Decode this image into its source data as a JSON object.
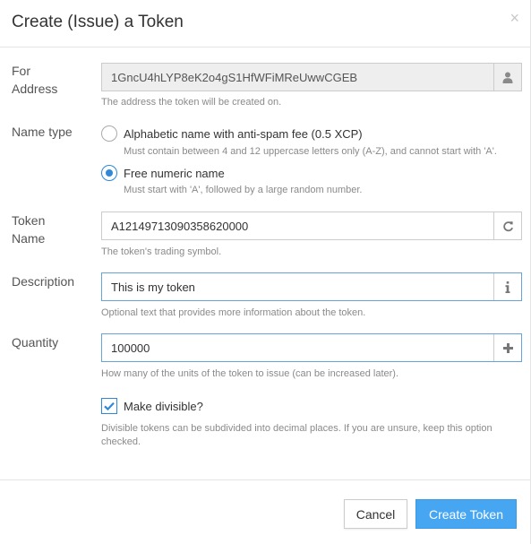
{
  "dialog": {
    "title": "Create (Issue) a Token",
    "close_glyph": "×"
  },
  "address": {
    "label_line1": "For",
    "label_line2": "Address",
    "value": "1GncU4hLYP8eK2o4gS1HfWFiMReUwwCGEB",
    "help": "The address the token will be created on.",
    "icon": "user-icon"
  },
  "name_type": {
    "label": "Name type",
    "options": [
      {
        "label": "Alphabetic name with anti-spam fee (0.5 XCP)",
        "help": "Must contain between 4 and 12 uppercase letters only (A-Z), and cannot start with 'A'.",
        "selected": false
      },
      {
        "label": "Free numeric name",
        "help": "Must start with 'A', followed by a large random number.",
        "selected": true
      }
    ]
  },
  "token_name": {
    "label_line1": "Token",
    "label_line2": "Name",
    "value": "A12149713090358620000",
    "help": "The token's trading symbol.",
    "icon": "refresh-icon"
  },
  "description": {
    "label": "Description",
    "value": "This is my token",
    "help": "Optional text that provides more information about the token.",
    "icon": "info-icon"
  },
  "quantity": {
    "label": "Quantity",
    "value": "100000",
    "help": "How many of the units of the token to issue (can be increased later).",
    "icon": "plus-icon"
  },
  "divisible": {
    "label": "Make divisible?",
    "checked": true,
    "help_line1": "Divisible tokens can be subdivided into decimal places. If you are unsure, keep this option",
    "help_line2": "checked."
  },
  "footer": {
    "cancel_label": "Cancel",
    "create_label": "Create Token"
  },
  "colors": {
    "accent": "#47a6f2",
    "focus_border": "#66a3d9",
    "radio_checked": "#2f88d8"
  }
}
